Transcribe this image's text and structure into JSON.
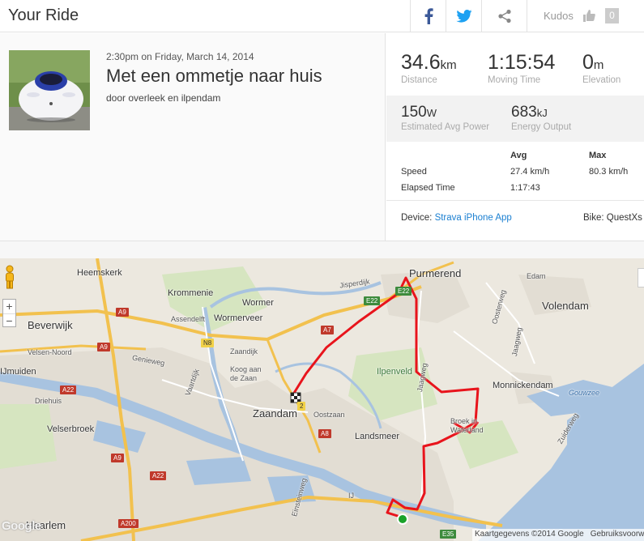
{
  "header": {
    "title": "Your Ride",
    "share": {
      "facebook_icon": "facebook-icon",
      "twitter_icon": "twitter-icon",
      "share_icon": "share-icon"
    },
    "kudos_label": "Kudos",
    "kudos_count": "0",
    "colors": {
      "facebook": "#3b5998",
      "twitter": "#1da1f2"
    }
  },
  "activity": {
    "date": "2:30pm on Friday, March 14, 2014",
    "name": "Met een ommetje naar huis",
    "description": "door overleek en ilpendam"
  },
  "stats": {
    "distance": {
      "value": "34.6",
      "unit": "km",
      "label": "Distance"
    },
    "moving_time": {
      "value": "1:15:54",
      "label": "Moving Time"
    },
    "elevation": {
      "value": "0",
      "unit": "m",
      "label": "Elevation"
    },
    "power": {
      "value": "150",
      "unit": "W",
      "label": "Estimated Avg Power"
    },
    "energy": {
      "value": "683",
      "unit": "kJ",
      "label": "Energy Output"
    },
    "table": {
      "headers": [
        "Avg",
        "Max"
      ],
      "rows": [
        {
          "label": "Speed",
          "avg": "27.4 km/h",
          "max": "80.3 km/h"
        },
        {
          "label": "Elapsed Time",
          "avg": "1:17:43",
          "max": ""
        }
      ]
    },
    "device_label": "Device:",
    "device_value": "Strava iPhone App",
    "bike": "Bike: QuestXs"
  },
  "map": {
    "places": {
      "purmerend": "Purmerend",
      "heemskerk": "Heemskerk",
      "krommenie": "Krommenie",
      "wormer": "Wormer",
      "wormerveer": "Wormerveer",
      "assendelft": "Assendelft",
      "beverwijk": "Beverwijk",
      "velsen_noord": "Velsen-Noord",
      "ijmuiden": "IJmuiden",
      "driehuis": "Driehuis",
      "velserbroek": "Velserbroek",
      "zaandijk": "Zaandijk",
      "koog": "Koog aan\nde Zaan",
      "zaandam": "Zaandam",
      "oostzaan": "Oostzaan",
      "landsmeer": "Landsmeer",
      "ilpenveld": "Ilpenveld",
      "broek": "Broek in\nWaterland",
      "monnickendam": "Monnickendam",
      "volendam": "Volendam",
      "edam": "Edam",
      "haarlem": "Haarlem",
      "ij": "IJ",
      "gouwzee": "Gouwzee",
      "jisperdijk": "Jisperdijk",
      "genieweg": "Genieweg",
      "vaartdijk": "Vaartdijk",
      "jaagweg": "Jaagweg",
      "jaagweg2": "Jaagweg",
      "oosterweg": "Oosterweg",
      "einsteinweg": "Einsteinweg",
      "zuiderweg": "Zuiderweg"
    },
    "shields": {
      "a9a": "A9",
      "a9b": "A9",
      "a9c": "A9",
      "a22a": "A22",
      "a22b": "A22",
      "a7": "A7",
      "a8": "A8",
      "a200": "A200",
      "e22a": "E22",
      "e22b": "E22",
      "e35": "E35",
      "n8": "N8",
      "n2": "2"
    },
    "zoom_in": "+",
    "zoom_out": "−",
    "attribution": "Kaartgegevens ©2014 Google",
    "terms": "Gebruiksvoorwaarden",
    "logo": "Google",
    "route_color": "#e8141c",
    "start_color": "#1aa229"
  }
}
